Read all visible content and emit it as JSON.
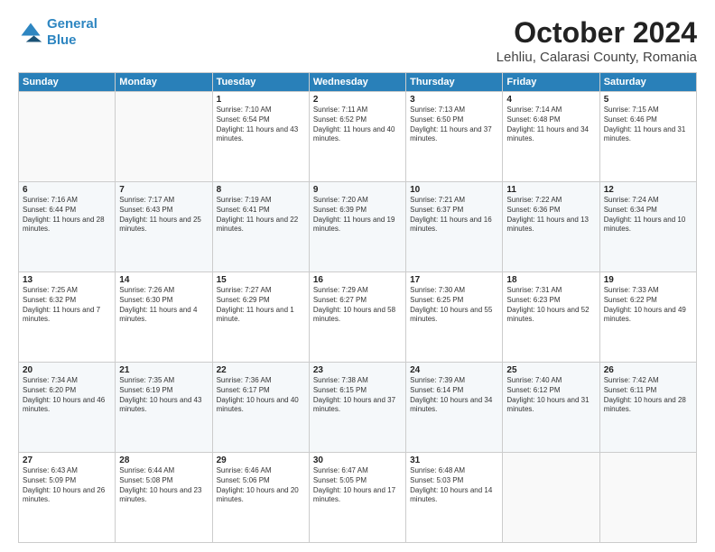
{
  "header": {
    "logo_line1": "General",
    "logo_line2": "Blue",
    "title": "October 2024",
    "subtitle": "Lehliu, Calarasi County, Romania"
  },
  "weekdays": [
    "Sunday",
    "Monday",
    "Tuesday",
    "Wednesday",
    "Thursday",
    "Friday",
    "Saturday"
  ],
  "weeks": [
    [
      {
        "day": "",
        "info": ""
      },
      {
        "day": "",
        "info": ""
      },
      {
        "day": "1",
        "info": "Sunrise: 7:10 AM\nSunset: 6:54 PM\nDaylight: 11 hours and 43 minutes."
      },
      {
        "day": "2",
        "info": "Sunrise: 7:11 AM\nSunset: 6:52 PM\nDaylight: 11 hours and 40 minutes."
      },
      {
        "day": "3",
        "info": "Sunrise: 7:13 AM\nSunset: 6:50 PM\nDaylight: 11 hours and 37 minutes."
      },
      {
        "day": "4",
        "info": "Sunrise: 7:14 AM\nSunset: 6:48 PM\nDaylight: 11 hours and 34 minutes."
      },
      {
        "day": "5",
        "info": "Sunrise: 7:15 AM\nSunset: 6:46 PM\nDaylight: 11 hours and 31 minutes."
      }
    ],
    [
      {
        "day": "6",
        "info": "Sunrise: 7:16 AM\nSunset: 6:44 PM\nDaylight: 11 hours and 28 minutes."
      },
      {
        "day": "7",
        "info": "Sunrise: 7:17 AM\nSunset: 6:43 PM\nDaylight: 11 hours and 25 minutes."
      },
      {
        "day": "8",
        "info": "Sunrise: 7:19 AM\nSunset: 6:41 PM\nDaylight: 11 hours and 22 minutes."
      },
      {
        "day": "9",
        "info": "Sunrise: 7:20 AM\nSunset: 6:39 PM\nDaylight: 11 hours and 19 minutes."
      },
      {
        "day": "10",
        "info": "Sunrise: 7:21 AM\nSunset: 6:37 PM\nDaylight: 11 hours and 16 minutes."
      },
      {
        "day": "11",
        "info": "Sunrise: 7:22 AM\nSunset: 6:36 PM\nDaylight: 11 hours and 13 minutes."
      },
      {
        "day": "12",
        "info": "Sunrise: 7:24 AM\nSunset: 6:34 PM\nDaylight: 11 hours and 10 minutes."
      }
    ],
    [
      {
        "day": "13",
        "info": "Sunrise: 7:25 AM\nSunset: 6:32 PM\nDaylight: 11 hours and 7 minutes."
      },
      {
        "day": "14",
        "info": "Sunrise: 7:26 AM\nSunset: 6:30 PM\nDaylight: 11 hours and 4 minutes."
      },
      {
        "day": "15",
        "info": "Sunrise: 7:27 AM\nSunset: 6:29 PM\nDaylight: 11 hours and 1 minute."
      },
      {
        "day": "16",
        "info": "Sunrise: 7:29 AM\nSunset: 6:27 PM\nDaylight: 10 hours and 58 minutes."
      },
      {
        "day": "17",
        "info": "Sunrise: 7:30 AM\nSunset: 6:25 PM\nDaylight: 10 hours and 55 minutes."
      },
      {
        "day": "18",
        "info": "Sunrise: 7:31 AM\nSunset: 6:23 PM\nDaylight: 10 hours and 52 minutes."
      },
      {
        "day": "19",
        "info": "Sunrise: 7:33 AM\nSunset: 6:22 PM\nDaylight: 10 hours and 49 minutes."
      }
    ],
    [
      {
        "day": "20",
        "info": "Sunrise: 7:34 AM\nSunset: 6:20 PM\nDaylight: 10 hours and 46 minutes."
      },
      {
        "day": "21",
        "info": "Sunrise: 7:35 AM\nSunset: 6:19 PM\nDaylight: 10 hours and 43 minutes."
      },
      {
        "day": "22",
        "info": "Sunrise: 7:36 AM\nSunset: 6:17 PM\nDaylight: 10 hours and 40 minutes."
      },
      {
        "day": "23",
        "info": "Sunrise: 7:38 AM\nSunset: 6:15 PM\nDaylight: 10 hours and 37 minutes."
      },
      {
        "day": "24",
        "info": "Sunrise: 7:39 AM\nSunset: 6:14 PM\nDaylight: 10 hours and 34 minutes."
      },
      {
        "day": "25",
        "info": "Sunrise: 7:40 AM\nSunset: 6:12 PM\nDaylight: 10 hours and 31 minutes."
      },
      {
        "day": "26",
        "info": "Sunrise: 7:42 AM\nSunset: 6:11 PM\nDaylight: 10 hours and 28 minutes."
      }
    ],
    [
      {
        "day": "27",
        "info": "Sunrise: 6:43 AM\nSunset: 5:09 PM\nDaylight: 10 hours and 26 minutes."
      },
      {
        "day": "28",
        "info": "Sunrise: 6:44 AM\nSunset: 5:08 PM\nDaylight: 10 hours and 23 minutes."
      },
      {
        "day": "29",
        "info": "Sunrise: 6:46 AM\nSunset: 5:06 PM\nDaylight: 10 hours and 20 minutes."
      },
      {
        "day": "30",
        "info": "Sunrise: 6:47 AM\nSunset: 5:05 PM\nDaylight: 10 hours and 17 minutes."
      },
      {
        "day": "31",
        "info": "Sunrise: 6:48 AM\nSunset: 5:03 PM\nDaylight: 10 hours and 14 minutes."
      },
      {
        "day": "",
        "info": ""
      },
      {
        "day": "",
        "info": ""
      }
    ]
  ]
}
